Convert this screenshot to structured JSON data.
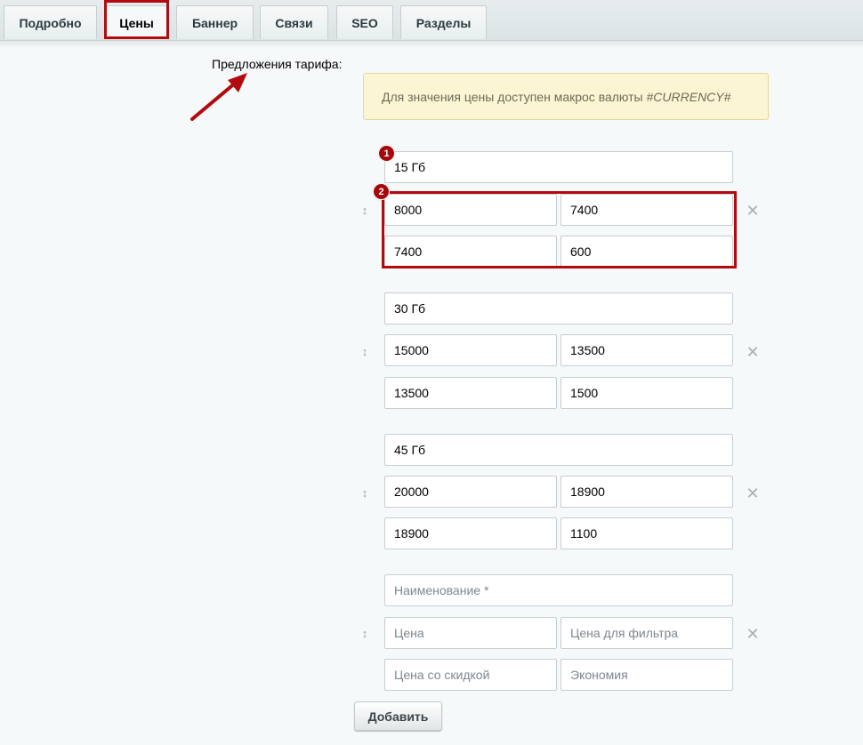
{
  "tabs": [
    {
      "label": "Подробно"
    },
    {
      "label": "Цены"
    },
    {
      "label": "Баннер"
    },
    {
      "label": "Связи"
    },
    {
      "label": "SEO"
    },
    {
      "label": "Разделы"
    }
  ],
  "section": {
    "label": "Предложения тарифа:",
    "hint_text": "Для значения цены доступен макрос валюты ",
    "hint_macro": "#CURRENCY#"
  },
  "rows": [
    {
      "name": "15 Гб",
      "price": "8000",
      "filter_price": "7400",
      "discount_price": "7400",
      "economy": "600"
    },
    {
      "name": "30 Гб",
      "price": "15000",
      "filter_price": "13500",
      "discount_price": "13500",
      "economy": "1500"
    },
    {
      "name": "45 Гб",
      "price": "20000",
      "filter_price": "18900",
      "discount_price": "18900",
      "economy": "1100"
    },
    {
      "name": "",
      "price": "",
      "filter_price": "",
      "discount_price": "",
      "economy": ""
    }
  ],
  "placeholders": {
    "name": "Наименование *",
    "price": "Цена",
    "filter_price": "Цена для фильтра",
    "discount_price": "Цена со скидкой",
    "economy": "Экономия"
  },
  "icons": {
    "drag": "↕",
    "delete": "✕"
  },
  "badges": [
    "1",
    "2"
  ],
  "add_button": "Добавить",
  "colors": {
    "highlight": "#b10b10",
    "hint_bg": "#fcf5d4"
  }
}
